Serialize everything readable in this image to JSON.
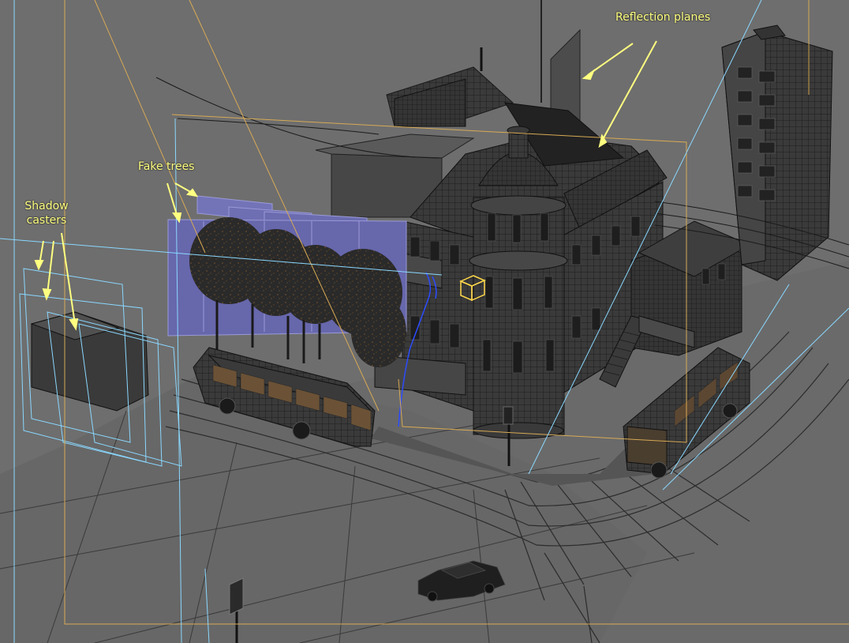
{
  "annotations": {
    "reflection_planes": "Reflection planes",
    "fake_trees": "Fake trees",
    "shadow_casters_line1": "Shadow",
    "shadow_casters_line2": "casters"
  },
  "colors": {
    "viewport_bg": "#6e6e6e",
    "annotation_text": "#ffff80",
    "selection_frame": "#d8aa55",
    "helper_lines": "#8ad8ff",
    "fake_tree_planes": "#6b6bb0",
    "wire_dark": "#2a2a2a",
    "selected_object": "#ffd84a"
  },
  "scene_objects": [
    "reflection-plane",
    "fake-tree-planes",
    "shadow-caster-boxes",
    "main-building",
    "dome-tower",
    "apartment-tower",
    "left-bus",
    "right-bus",
    "car",
    "street-sign",
    "selected-light-helper",
    "road-grid"
  ]
}
